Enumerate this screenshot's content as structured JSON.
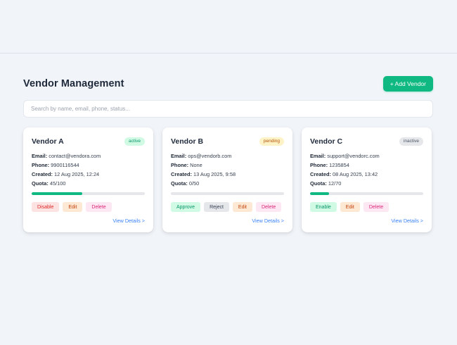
{
  "header": {
    "title": "Vendor Management",
    "add_label": "+ Add Vendor"
  },
  "search": {
    "placeholder": "Search by name, email, phone, status..."
  },
  "labels": {
    "email": "Email:",
    "phone": "Phone:",
    "created": "Created:",
    "quota": "Quota:",
    "view_details": "View Details >"
  },
  "colors": {
    "accent": "#10b981",
    "link": "#3b82f6"
  },
  "vendors": [
    {
      "name": "Vendor A",
      "status": "active",
      "email": "contact@vendora.com",
      "phone": "9900116544",
      "created": "12 Aug 2025, 12:24",
      "quota": "45/100",
      "quota_fraction": 0.45,
      "actions": [
        "Disable",
        "Edit",
        "Delete"
      ]
    },
    {
      "name": "Vendor B",
      "status": "pending",
      "email": "ops@vendorb.com",
      "phone": "None",
      "created": "13 Aug 2025, 9:58",
      "quota": "0/50",
      "quota_fraction": 0.0,
      "actions": [
        "Approve",
        "Reject",
        "Edit",
        "Delete"
      ]
    },
    {
      "name": "Vendor C",
      "status": "inactive",
      "email": "support@vendorc.com",
      "phone": "1235854",
      "created": "08 Aug 2025, 13:42",
      "quota": "12/70",
      "quota_fraction": 0.17,
      "actions": [
        "Enable",
        "Edit",
        "Delete"
      ]
    }
  ]
}
